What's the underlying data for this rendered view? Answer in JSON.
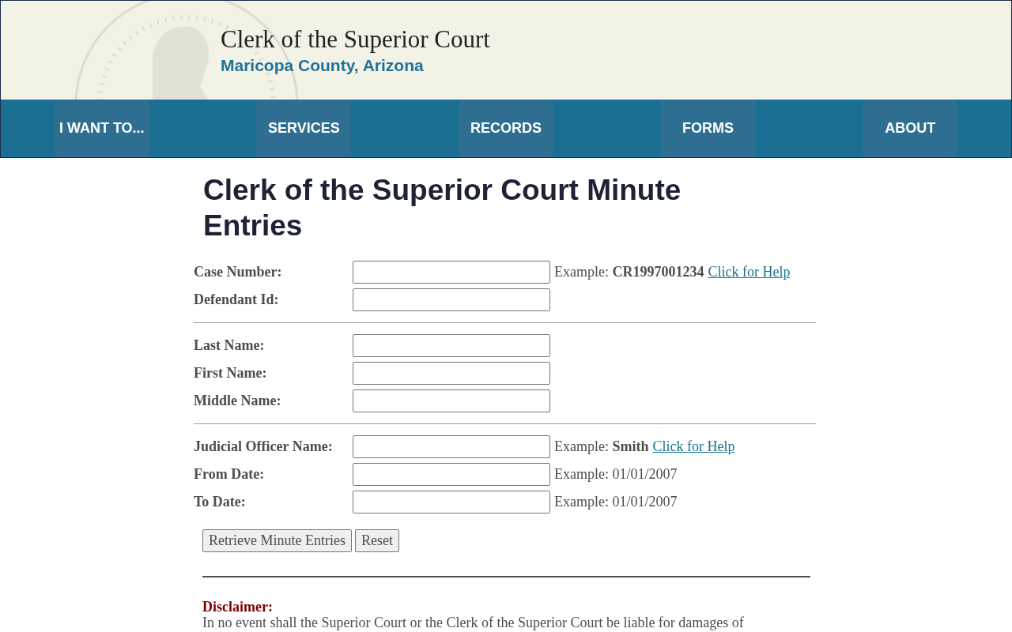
{
  "header": {
    "title": "Clerk of the Superior Court",
    "subtitle": "Maricopa County, Arizona"
  },
  "nav": [
    {
      "label": "I WANT TO..."
    },
    {
      "label": "SERVICES"
    },
    {
      "label": "RECORDS"
    },
    {
      "label": "FORMS"
    },
    {
      "label": "ABOUT"
    }
  ],
  "page_title": "Clerk of the Superior Court Minute Entries",
  "form_sections": [
    [
      {
        "label": "Case Number:",
        "example": "Example: **CR1997001234**",
        "help_link": "Click for Help"
      },
      {
        "label": "Defendant Id:"
      }
    ],
    [
      {
        "label": "Last Name:"
      },
      {
        "label": "First Name:"
      },
      {
        "label": "Middle Name:"
      }
    ],
    [
      {
        "label": "Judicial Officer Name:",
        "example": "Example: **Smith**",
        "help_link": "Click for Help"
      },
      {
        "label": "From Date:",
        "example": "Example: 01/01/2007"
      },
      {
        "label": "To Date:",
        "example": "Example: 01/01/2007"
      }
    ]
  ],
  "buttons": [
    "Retrieve Minute Entries",
    "Reset"
  ],
  "disclaimer": {
    "heading": "Disclaimer:",
    "text": "In no event shall the Superior Court or the Clerk of the Superior Court be liable for damages of"
  }
}
